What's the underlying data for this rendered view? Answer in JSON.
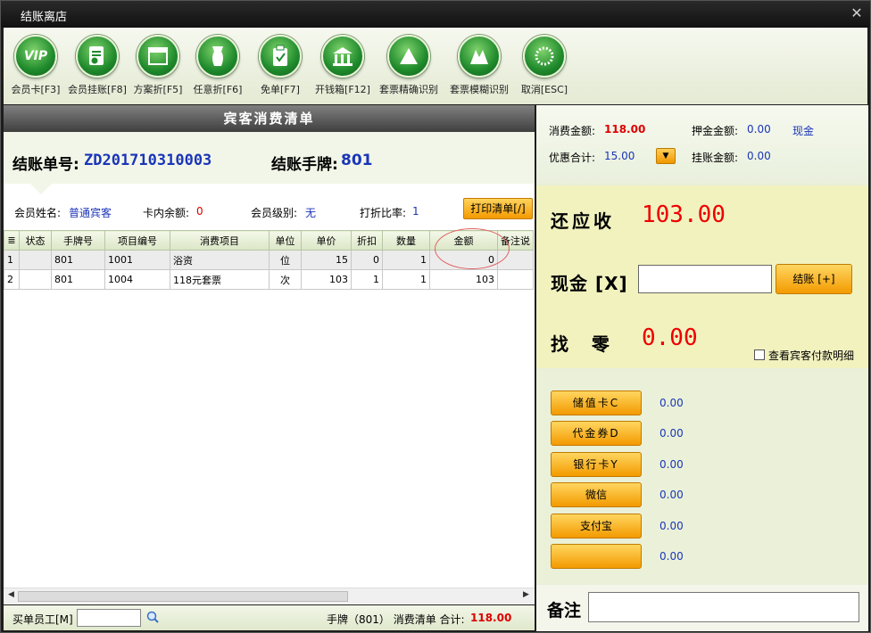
{
  "window": {
    "title": "结账离店"
  },
  "toolbar": {
    "buttons": [
      {
        "label": "会员卡[F3]",
        "icon": "vip-icon"
      },
      {
        "label": "会员挂账[F8]",
        "icon": "member-charge-icon"
      },
      {
        "label": "方案折[F5]",
        "icon": "scheme-discount-icon"
      },
      {
        "label": "任意折[F6]",
        "icon": "any-discount-icon"
      },
      {
        "label": "免单[F7]",
        "icon": "free-order-icon"
      },
      {
        "label": "开钱箱[F12]",
        "icon": "cash-drawer-icon"
      },
      {
        "label": "套票精确识别",
        "icon": "ticket-exact-icon"
      },
      {
        "label": "套票模糊识别",
        "icon": "ticket-fuzzy-icon"
      },
      {
        "label": "取消[ESC]",
        "icon": "cancel-icon"
      }
    ]
  },
  "bill": {
    "section_title": "宾客消费清单",
    "bill_no_label": "结账单号:",
    "bill_no": "ZD201710310003",
    "tag_label": "结账手牌:",
    "tag": "801"
  },
  "member": {
    "name_label": "会员姓名:",
    "name": "普通宾客",
    "balance_label": "卡内余额:",
    "balance": "0",
    "level_label": "会员级别:",
    "level": "无",
    "discount_label": "打折比率:",
    "discount": "1",
    "print_button": "打印清单[/]"
  },
  "table": {
    "columns": [
      "状态",
      "手牌号",
      "项目编号",
      "消费项目",
      "单位",
      "单价",
      "折扣",
      "数量",
      "金额",
      "备注说"
    ],
    "rows": [
      {
        "idx": "1",
        "status": "",
        "tag": "801",
        "code": "1001",
        "item": "浴资",
        "unit": "位",
        "price": "15",
        "discount": "0",
        "qty": "1",
        "amount": "0",
        "note": ""
      },
      {
        "idx": "2",
        "status": "",
        "tag": "801",
        "code": "1004",
        "item": "118元套票",
        "unit": "次",
        "price": "103",
        "discount": "1",
        "qty": "1",
        "amount": "103",
        "note": ""
      }
    ]
  },
  "status_bar": {
    "staff_label": "买单员工[M]",
    "summary": "手牌（801） 消费清单 合计:",
    "total": "118.00"
  },
  "summary": {
    "consume_label": "消费金额:",
    "consume": "118.00",
    "deposit_label": "押金金额:",
    "deposit": "0.00",
    "deposit_type": "现金",
    "discount_total_label": "优惠合计:",
    "discount_total": "15.00",
    "credit_label": "挂账金额:",
    "credit": "0.00"
  },
  "payment": {
    "receivable_label": "还应收",
    "receivable": "103.00",
    "cash_label": "现金 [X]",
    "checkout_button": "结账 [+]",
    "change_label": "找  零",
    "change": "0.00",
    "detail_checkbox": "查看宾客付款明细",
    "methods": [
      {
        "label": "储值卡C",
        "amount": "0.00"
      },
      {
        "label": "代金券D",
        "amount": "0.00"
      },
      {
        "label": "银行卡Y",
        "amount": "0.00"
      },
      {
        "label": "微信",
        "amount": "0.00"
      },
      {
        "label": "支付宝",
        "amount": "0.00"
      },
      {
        "label": "",
        "amount": "0.00"
      }
    ],
    "note_label": "备注"
  },
  "colors": {
    "accent_orange": "#f39a00",
    "amount_red": "#dd0000",
    "value_blue": "#1b35b8"
  }
}
